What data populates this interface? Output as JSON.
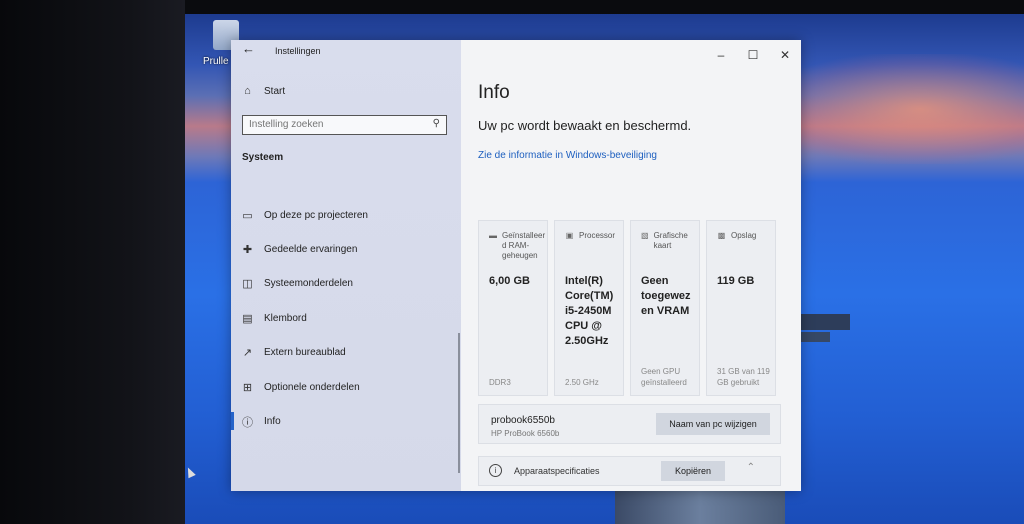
{
  "desktop": {
    "recycle_bin_label": "Prulle"
  },
  "window": {
    "title": "Instellingen",
    "controls": {
      "minimize": "–",
      "maximize": "☐",
      "close": "✕"
    }
  },
  "sidebar": {
    "home_label": "Start",
    "search_placeholder": "Instelling zoeken",
    "section_heading": "Systeem",
    "items": [
      {
        "label": "Op deze pc projecteren",
        "icon": "project-icon"
      },
      {
        "label": "Gedeelde ervaringen",
        "icon": "shared-experiences-icon"
      },
      {
        "label": "Systeemonderdelen",
        "icon": "system-components-icon"
      },
      {
        "label": "Klembord",
        "icon": "clipboard-icon"
      },
      {
        "label": "Extern bureaublad",
        "icon": "remote-desktop-icon"
      },
      {
        "label": "Optionele onderdelen",
        "icon": "optional-features-icon"
      },
      {
        "label": "Info",
        "icon": "info-icon",
        "active": true
      }
    ]
  },
  "content": {
    "page_title": "Info",
    "status_line": "Uw pc wordt bewaakt en beschermd.",
    "security_link": "Zie de informatie in Windows-beveiliging",
    "cards": [
      {
        "label": "Geïnstalleer d RAM-geheugen",
        "value": "6,00 GB",
        "footer": "DDR3",
        "icon": "ram-icon"
      },
      {
        "label": "Processor",
        "value": "Intel(R) Core(TM) i5-2450M CPU @ 2.50GHz",
        "footer": "2.50 GHz",
        "icon": "processor-icon"
      },
      {
        "label": "Grafische kaart",
        "value": "Geen toegewez en VRAM",
        "footer": "Geen GPU geïnstalleerd",
        "icon": "graphics-card-icon"
      },
      {
        "label": "Opslag",
        "value": "119 GB",
        "footer": "31 GB van 119 GB gebruikt",
        "icon": "storage-icon"
      }
    ],
    "pc_name": "probook6550b",
    "pc_model": "HP ProBook 6560b",
    "rename_button": "Naam van pc wijzigen",
    "specs_label": "Apparaatspecificaties",
    "copy_button": "Kopiëren"
  }
}
